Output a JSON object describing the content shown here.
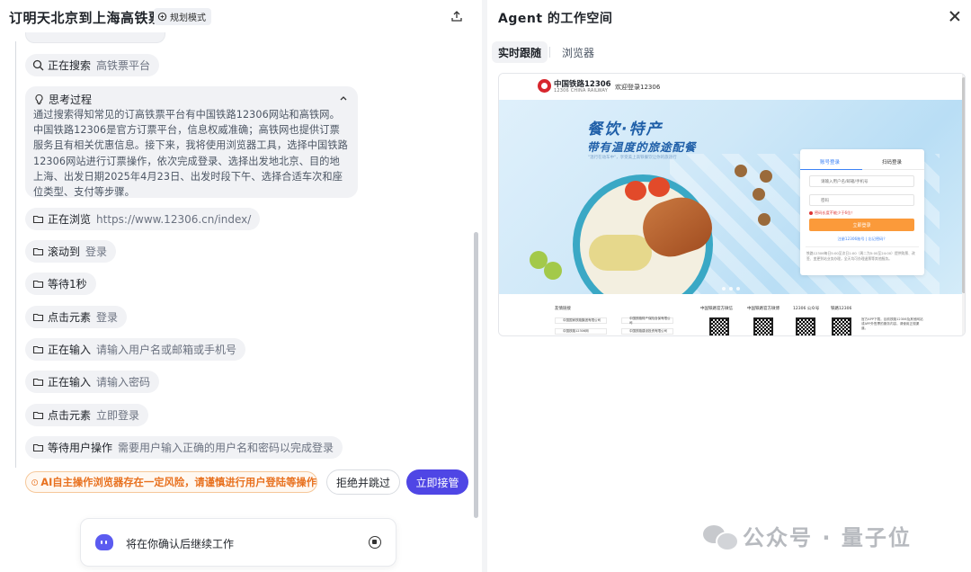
{
  "left": {
    "title": "订明天北京到上海高铁票",
    "mode_badge": "规划模式",
    "steps": [
      {
        "label": "正在搜索",
        "value": "高铁票平台",
        "icon": "search-icon"
      },
      {
        "label": "正在浏览",
        "value": "https://www.12306.cn/index/",
        "icon": "folder-icon"
      },
      {
        "label": "滚动到",
        "value": "登录",
        "icon": "folder-icon"
      },
      {
        "label": "等待1秒",
        "value": "",
        "icon": "folder-icon"
      },
      {
        "label": "点击元素",
        "value": "登录",
        "icon": "folder-icon"
      },
      {
        "label": "正在输入",
        "value": "请输入用户名或邮箱或手机号",
        "icon": "folder-icon"
      },
      {
        "label": "正在输入",
        "value": "请输入密码",
        "icon": "folder-icon"
      },
      {
        "label": "点击元素",
        "value": "立即登录",
        "icon": "folder-icon"
      },
      {
        "label": "等待用户操作",
        "value": "需要用户输入正确的用户名和密码以完成登录",
        "icon": "folder-icon"
      }
    ],
    "thinking": {
      "title": "思考过程",
      "body": "通过搜索得知常见的订高铁票平台有中国铁路12306网站和高铁网。中国铁路12306是官方订票平台，信息权威准确；高铁网也提供订票服务且有相关优惠信息。接下来，我将使用浏览器工具，选择中国铁路12306网站进行订票操作，依次完成登录、选择出发地北京、目的地上海、出发日期2025年4月23日、出发时段下午、选择合适车次和座位类型、支付等步骤。"
    },
    "warning": "AI自主操作浏览器存在一定风险，请谨慎进行用户登陆等操作",
    "reject_button": "拒绝并跳过",
    "takeover_button": "立即接管",
    "bottom_status": "将在你确认后继续工作"
  },
  "right": {
    "title": "Agent 的工作空间",
    "tabs": [
      "实时跟随",
      "浏览器"
    ],
    "active_tab": "实时跟随",
    "browser": {
      "site_name": "中国铁路12306",
      "site_sub": "12306 CHINA RAILWAY",
      "welcome": "欢迎登录12306",
      "banner_title": "餐饮·特产",
      "banner_subtitle": "带有温度的旅途配餐",
      "banner_small": "\"温行在动车中\"，享受美上高铁餐饮让你的旅途行",
      "login_tab_account": "账号登录",
      "login_tab_scan": "扫码登录",
      "username_placeholder": "请输入用户名/邮箱/手机号",
      "password_placeholder": "密码",
      "login_error": "密码长度不能少于6位！",
      "login_button": "立即登录",
      "login_links": "注册12306账号 | 忘记密码？",
      "login_note": "铁路12306每日5:00至次日1:00（周二为5:00至24:00）提供购票、改签、变更到站业务办理，全天均可办理退票等其他服务。",
      "footer_labels": [
        "友情链接",
        "中国铁路官方微信",
        "中国铁路官方微博",
        "12306 公众号",
        "铁路12306"
      ],
      "footer_logos": [
        "中国国家铁路集团有限公司",
        "中国铁路财产保险自保有限公司",
        "中国铁路12306网",
        "中国铁路建设投资有限公司"
      ],
      "footer_note": "官方APP下载，目前铁路12306及其他网站或APP外售票的服务内容，请使用正规渠道。"
    }
  },
  "watermark": "公众号 · 量子位",
  "colors": {
    "accent": "#4f46e5",
    "warning": "#e8711f",
    "rail_red": "#d7262d",
    "login_orange": "#fb9a3a"
  }
}
